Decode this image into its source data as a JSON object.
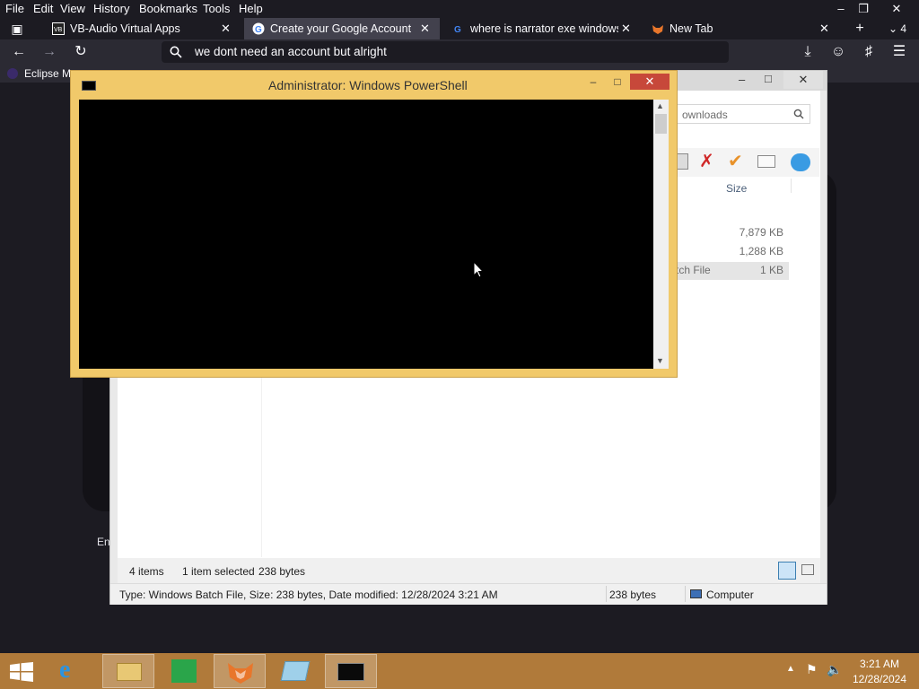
{
  "browser": {
    "menu": [
      "File",
      "Edit",
      "View",
      "History",
      "Bookmarks",
      "Tools",
      "Help"
    ],
    "tabs": [
      {
        "title": "VB-Audio Virtual Apps"
      },
      {
        "title": "Create your Google Account"
      },
      {
        "title": "where is narrator exe windows -"
      },
      {
        "title": "New Tab"
      }
    ],
    "tab_count": "4",
    "url": "we dont need an account but alright",
    "bookmark": "Eclipse M",
    "page_fragment": "En"
  },
  "explorer": {
    "search_text": "ownloads",
    "size_header": "Size",
    "rows": [
      {
        "type": "",
        "size": "7,879 KB"
      },
      {
        "type": "",
        "size": "1,288 KB"
      },
      {
        "type": "tch File",
        "size": "1 KB"
      }
    ],
    "status": {
      "items": "4 items",
      "selected": "1 item selected",
      "bytes": "238 bytes"
    },
    "details": "Type: Windows Batch File, Size: 238 bytes, Date modified: 12/28/2024 3:21 AM",
    "details_size": "238 bytes",
    "computer": "Computer"
  },
  "powershell": {
    "title": "Administrator: Windows PowerShell"
  },
  "taskbar": {
    "time": "3:21 AM",
    "date": "12/28/2024"
  },
  "colors": {
    "browser_bg": "#1c1b22",
    "powershell_frame": "#f1c96a",
    "taskbar": "#b07a3a"
  }
}
